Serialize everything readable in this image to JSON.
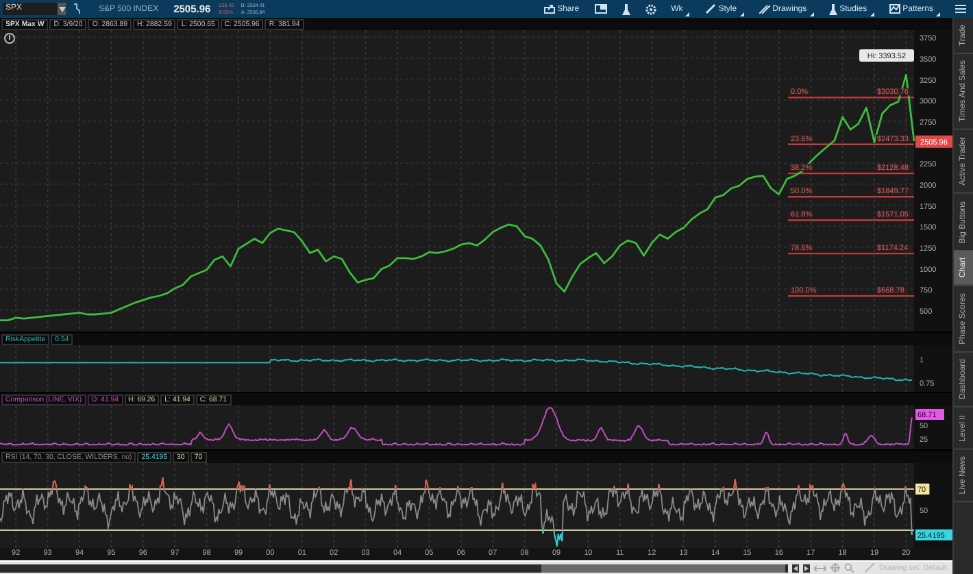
{
  "symbol_bar": {
    "symbol": "SPX",
    "description": "S&P 500 INDEX",
    "last": "2505.96",
    "change": "-235.42",
    "change_pct": "-8.59%",
    "bid": "B: 2504.41",
    "ask": "A: 2506.84"
  },
  "toolbar": [
    {
      "kind": "share",
      "label": "Share"
    },
    {
      "kind": "window"
    },
    {
      "kind": "flask"
    },
    {
      "kind": "gear"
    },
    {
      "kind": "text",
      "label": "Wk"
    },
    {
      "kind": "style",
      "label": "Style"
    },
    {
      "kind": "drawings",
      "label": "Drawings"
    },
    {
      "kind": "studies",
      "label": "Studies"
    },
    {
      "kind": "patterns",
      "label": "Patterns"
    },
    {
      "kind": "menu"
    }
  ],
  "header": [
    "SPX Max W",
    "D: 3/9/20",
    "O: 2863.89",
    "H: 2882.59",
    "L: 2500.65",
    "C: 2505.96",
    "R: 381.94"
  ],
  "price_chart": {
    "high_label": "Hi: 3393.52",
    "last_price": "2505.96",
    "fibonacci": [
      {
        "label": "0.0%",
        "price": "$3030.76"
      },
      {
        "label": "23.6%",
        "price": "$2473.33"
      },
      {
        "label": "38.2%",
        "price": "$2128.48"
      },
      {
        "label": "50.0%",
        "price": "$1849.77"
      },
      {
        "label": "61.8%",
        "price": "$1571.05"
      },
      {
        "label": "78.6%",
        "price": "$1174.24"
      },
      {
        "label": "100.0%",
        "price": "$668.78"
      }
    ],
    "chart_data": {
      "type": "line",
      "grid": true,
      "ylim": [
        246,
        3833
      ],
      "yticks": [
        500,
        750,
        1000,
        1250,
        1500,
        1750,
        2000,
        2250,
        2750,
        3000,
        3250,
        3500,
        3750
      ],
      "categories": [
        null,
        null,
        null,
        null,
        null,
        null,
        null,
        null,
        null,
        null,
        null,
        null,
        null,
        null,
        null,
        null,
        null,
        null,
        null,
        null,
        null,
        null,
        null,
        null,
        null,
        null,
        null,
        null,
        null,
        null,
        null,
        null,
        null,
        null,
        null,
        null,
        null,
        null,
        null,
        null,
        null,
        null,
        null,
        null,
        null,
        null,
        null,
        null,
        null,
        null,
        null,
        null,
        null,
        null,
        null,
        null,
        null,
        null,
        null,
        null,
        null,
        null,
        null,
        null,
        null,
        null,
        null,
        null,
        null,
        null,
        null,
        null,
        null,
        null,
        null,
        null,
        null,
        null,
        null,
        null,
        null,
        null,
        null,
        null,
        null,
        null,
        null,
        null,
        null,
        null,
        null,
        null,
        null,
        null,
        null,
        null,
        null,
        null,
        null,
        null,
        null,
        null,
        null,
        null,
        null,
        null,
        null,
        null,
        null,
        null,
        null,
        null,
        null,
        null,
        null,
        null
      ],
      "series": [
        {
          "color": "#3dbb3d",
          "values": [
            380,
            380,
            410,
            400,
            410,
            420,
            430,
            440,
            450,
            460,
            470,
            450,
            450,
            460,
            470,
            510,
            550,
            590,
            620,
            650,
            670,
            700,
            760,
            800,
            900,
            940,
            980,
            1100,
            1140,
            1020,
            1230,
            1290,
            1350,
            1300,
            1420,
            1470,
            1450,
            1430,
            1320,
            1180,
            1220,
            1080,
            1140,
            1110,
            950,
            830,
            860,
            880,
            990,
            1030,
            1120,
            1120,
            1110,
            1140,
            1190,
            1180,
            1200,
            1230,
            1280,
            1300,
            1270,
            1340,
            1430,
            1480,
            1520,
            1500,
            1380,
            1350,
            1270,
            1100,
            820,
            720,
            900,
            1050,
            1120,
            1180,
            1060,
            1140,
            1270,
            1330,
            1300,
            1150,
            1300,
            1400,
            1350,
            1430,
            1480,
            1580,
            1650,
            1700,
            1840,
            1870,
            1950,
            1980,
            2060,
            2090,
            2100,
            1950,
            1880,
            2060,
            2100,
            2160,
            2270,
            2360,
            2440,
            2520,
            2800,
            2650,
            2720,
            2910,
            2500,
            2840,
            2940,
            2980,
            3300,
            2510
          ]
        }
      ]
    }
  },
  "studies": [
    {
      "kind": "risk",
      "title": "RiskAppetite",
      "values": [
        "0.54"
      ],
      "axis": [
        {
          "label": "1",
          "badge": false
        },
        {
          "label": "0.75",
          "badge": false
        }
      ]
    },
    {
      "kind": "comparison",
      "title": "Comparison (LINE, VIX)",
      "values": [
        "O: 41.94",
        "H: 69.26",
        "L: 41.94",
        "C: 68.71"
      ],
      "axis": [
        {
          "label": "68.71",
          "badge": true
        },
        {
          "label": "50",
          "badge": false
        },
        {
          "label": "25",
          "badge": false
        }
      ]
    },
    {
      "kind": "rsi",
      "title": "RSI (14, 70, 30, CLOSE, WILDERS, no)",
      "values": [
        "25.4195",
        "30",
        "70"
      ],
      "axis": [
        {
          "label": "70",
          "badge": true
        },
        {
          "label": "50",
          "badge": false
        },
        {
          "label": "25.4195",
          "badge": true
        }
      ]
    }
  ],
  "time_axis": [
    "92",
    "93",
    "94",
    "95",
    "96",
    "97",
    "98",
    "99",
    "00",
    "01",
    "02",
    "03",
    "04",
    "05",
    "06",
    "07",
    "08",
    "09",
    "10",
    "11",
    "12",
    "13",
    "14",
    "15",
    "16",
    "17",
    "18",
    "19",
    "20"
  ],
  "drawing_set": "Drawing set: Default",
  "side_tabs": [
    {
      "label": "Trade",
      "selected": false
    },
    {
      "label": "Times And Sales",
      "selected": false
    },
    {
      "label": "Active Trader",
      "selected": false
    },
    {
      "label": "Big Buttons",
      "selected": false
    },
    {
      "label": "Chart",
      "selected": true
    },
    {
      "label": "Phase Scores",
      "selected": false
    },
    {
      "label": "Dashboard",
      "selected": false
    },
    {
      "label": "Level II",
      "selected": false
    },
    {
      "label": "Live News",
      "selected": false
    }
  ]
}
